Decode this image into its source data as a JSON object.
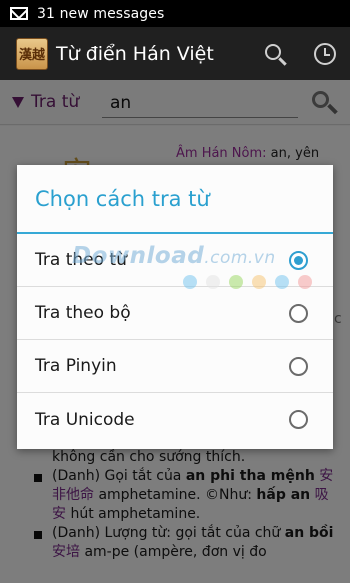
{
  "status_bar": {
    "notification_text": "31 new messages"
  },
  "action_bar": {
    "logo_text": "漢越",
    "title": "Từ điển Hán Việt"
  },
  "search": {
    "mode_label": "Tra từ",
    "query": "an"
  },
  "content": {
    "hanom_label": "Âm Hán Nôm:",
    "hanom_value": " an, yên",
    "hanzi": "安",
    "faded_letter": "c",
    "definitions": [
      {
        "text_a": "không cần cho sướng thích."
      },
      {
        "text_a": "(Danh) Gọi tắt của ",
        "bold_a": "an phi tha mệnh",
        "han_a": "安非他命",
        "text_b": " amphetamine. ©Như: ",
        "bold_b": "hấp an",
        "han_b": " 吸安",
        "text_c": " hút amphetamine."
      },
      {
        "text_a": "(Danh) Lượng từ: gọi tắt của chữ ",
        "bold_a": "an bồi",
        "han_a": " 安培",
        "text_b": " am-pe (ampère, đơn vị đo"
      }
    ]
  },
  "dialog": {
    "title": "Chọn cách tra từ",
    "options": [
      {
        "label": "Tra theo từ",
        "checked": true
      },
      {
        "label": "Tra theo bộ",
        "checked": false
      },
      {
        "label": "Tra Pinyin",
        "checked": false
      },
      {
        "label": "Tra Unicode",
        "checked": false
      }
    ]
  },
  "watermark": {
    "text": "Download",
    "suffix": ".com.vn",
    "dot_colors": [
      "#7cc6ef",
      "#e3e3e3",
      "#9fd86a",
      "#f5c77a",
      "#7cc6ef",
      "#f2a0a0"
    ]
  }
}
